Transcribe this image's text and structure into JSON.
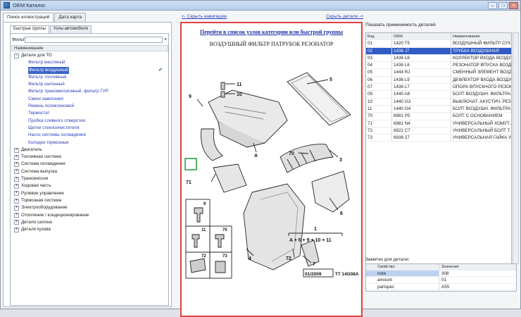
{
  "window": {
    "title": "OEM Каталог"
  },
  "left": {
    "tabs": [
      "Поиск иллюстраций",
      "Дата карта"
    ],
    "subtabs": [
      "Быстрые группы",
      "Узлы автомобиля"
    ],
    "filter_label": "Фильтр",
    "filter_value": "",
    "column_header": "Наименование",
    "tree": [
      {
        "label": "Детали для ТО",
        "expanded": true,
        "children": [
          {
            "label": "Фильтр масляный"
          },
          {
            "label": "Фильтр воздушный",
            "selected": true
          },
          {
            "label": "Фильтр топливный"
          },
          {
            "label": "Фильтр салонный"
          },
          {
            "label": "Фильтр трансмиссионный, фильтр ГУР"
          },
          {
            "label": "Свечи зажигания"
          },
          {
            "label": "Ремень поликлиновой"
          },
          {
            "label": "Термостат"
          },
          {
            "label": "Пробка сливного отверстия"
          },
          {
            "label": "Щетки стеклоочистителя"
          },
          {
            "label": "Насос системы охлаждения"
          },
          {
            "label": "Колодки тормозные"
          }
        ]
      },
      {
        "label": "Двигатель"
      },
      {
        "label": "Топливная система"
      },
      {
        "label": "Система охлаждения"
      },
      {
        "label": "Система выпуска"
      },
      {
        "label": "Трансмиссия"
      },
      {
        "label": "Ходовая часть"
      },
      {
        "label": "Рулевое управление"
      },
      {
        "label": "Тормозная система"
      },
      {
        "label": "Электрооборудование"
      },
      {
        "label": "Отопление / кондиционирование"
      },
      {
        "label": "Детали салона"
      },
      {
        "label": "Детали кузова"
      }
    ]
  },
  "center": {
    "hide_nav": "<- Скрыть навигацию",
    "hide_details": "Скрыть детали ->",
    "figure_link": "Перейти в список узлов категории или быстрой группы",
    "figure_title": "ВОЗДУШНЫЙ ФИЛЬТР ПАТРУБОК РЕЗОНАТОР",
    "callouts": [
      "11",
      "10",
      "9",
      "5",
      "70",
      "3",
      "A",
      "6",
      "71",
      "4",
      "72",
      "7"
    ],
    "formula": "A + 5 + 9 + 10 + 11",
    "formula_top": "1",
    "kit_labels": [
      "9",
      "11",
      "70",
      "72",
      "73"
    ],
    "date_code": "01/2009",
    "drawing_code": "T7 14G08A"
  },
  "right": {
    "applicability_label": "Показать применимость деталей",
    "parts_headers": [
      "Код",
      "OEM",
      "Наименование"
    ],
    "parts": [
      {
        "code": "01",
        "oem": "1420 T5",
        "name": "ВОЗДУШНЫЙ ФИЛЬТР СУХ..."
      },
      {
        "code": "02",
        "oem": "1436 J7",
        "name": "ТРУБКА ВОЗДУШНАЯ",
        "selected": true
      },
      {
        "code": "03",
        "oem": "1436 L8",
        "name": "КОЛЛЕКТОР ВХОДА ВОЗДУ..."
      },
      {
        "code": "04",
        "oem": "1436 L6",
        "name": "РЕЗОНАТОР ВПУСКА ВОЗД..."
      },
      {
        "code": "05",
        "oem": "1444 RJ",
        "name": "СМЕННЫЙ ЭЛЕМЕНТ ВОЗДУ..."
      },
      {
        "code": "06",
        "oem": "1436 L9",
        "name": "ДЕФЛЕКТОР ВХОДА ВОЗДУ..."
      },
      {
        "code": "07",
        "oem": "1436 L7",
        "name": "ОПОРА ВПУСКНОГО РЕЗОН..."
      },
      {
        "code": "09",
        "oem": "1440 A8",
        "name": "БОЛТ ВОЗДУШН. ФИЛЬТРА..."
      },
      {
        "code": "10",
        "oem": "1440 G3",
        "name": "ВЫКЛЮЧАТ. АКУСТИЧ. РЕЗ..."
      },
      {
        "code": "11",
        "oem": "1440 G4",
        "name": "БОЛТ ВОЗДУШН. ФИЛЬТРА..."
      },
      {
        "code": "70",
        "oem": "6981 P5",
        "name": "БОЛТ С ОСНОВАНИЕМ"
      },
      {
        "code": "71",
        "oem": "6981 N4",
        "name": "УНИВЕРСАЛЬНЫЙ ХОМУТ..."
      },
      {
        "code": "72",
        "oem": "6922 C7",
        "name": "УНИВЕРСАЛЬНЫЙ БОЛТ Т..."
      },
      {
        "code": "73",
        "oem": "6938 27",
        "name": "УНИВЕРСАЛЬНАЯ ГАЙКА У..."
      }
    ],
    "notes_label": "Заметки для детали:",
    "props_headers": [
      "Свойство",
      "Значение"
    ],
    "props": [
      {
        "key": "note",
        "value": "308",
        "selected": true
      },
      {
        "key": "amount",
        "value": "01"
      },
      {
        "key": "partspec",
        "value": "A55"
      }
    ]
  },
  "colors": {
    "highlight": "#2f5bc4",
    "figure_border": "#e24040",
    "link": "#2a3fb8"
  }
}
